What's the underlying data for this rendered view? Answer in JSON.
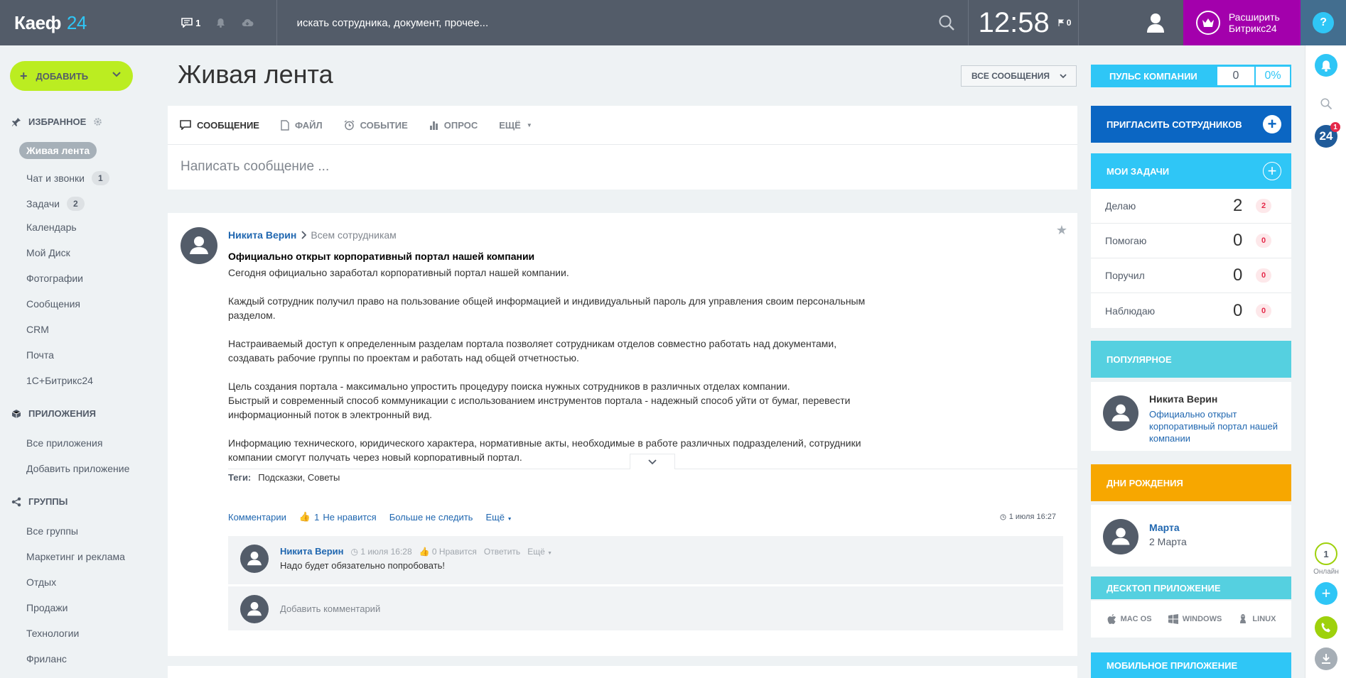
{
  "header": {
    "logo_text": "Каеф",
    "logo_num": "24",
    "chat_count": "1",
    "search_placeholder": "искать сотрудника, документ, прочее...",
    "time": "12:58",
    "flag_count": "0",
    "expand_line1": "Расширить",
    "expand_line2": "Битрикс24",
    "help": "?"
  },
  "sidebar": {
    "add_label": "ДОБАВИТЬ",
    "favorites_label": "ИЗБРАННОЕ",
    "favorites": [
      {
        "label": "Живая лента"
      },
      {
        "label": "Чат и звонки",
        "badge": "1"
      },
      {
        "label": "Задачи",
        "badge": "2"
      },
      {
        "label": "Календарь"
      },
      {
        "label": "Мой Диск"
      },
      {
        "label": "Фотографии"
      },
      {
        "label": "Сообщения"
      },
      {
        "label": "CRM"
      },
      {
        "label": "Почта"
      },
      {
        "label": "1С+Битрикс24"
      }
    ],
    "apps_label": "ПРИЛОЖЕНИЯ",
    "apps": [
      {
        "label": "Все приложения"
      },
      {
        "label": "Добавить приложение"
      }
    ],
    "groups_label": "ГРУППЫ",
    "groups": [
      {
        "label": "Все группы"
      },
      {
        "label": "Маркетинг и реклама"
      },
      {
        "label": "Отдых"
      },
      {
        "label": "Продажи"
      },
      {
        "label": "Технологии"
      },
      {
        "label": "Фриланс"
      }
    ]
  },
  "main": {
    "title": "Живая лента",
    "filter_label": "ВСЕ СООБЩЕНИЯ",
    "composer": {
      "tabs": [
        "СООБЩЕНИЕ",
        "ФАЙЛ",
        "СОБЫТИЕ",
        "ОПРОС",
        "ЕЩЁ"
      ],
      "placeholder": "Написать сообщение ..."
    },
    "post": {
      "author": "Никита Верин",
      "destination": "Всем сотрудникам",
      "title": "Официально открыт корпоративный портал нашей компании",
      "paragraphs": [
        "Сегодня официально заработал корпоративный портал нашей компании.",
        "Каждый сотрудник получил право на пользование общей информацией и индивидуальный пароль для управления своим персональным разделом.",
        "Настраиваемый доступ к определенным разделам портала позволяет сотрудникам отделов совместно работать над документами, создавать рабочие группы по проектам и работать над общей отчетностью.",
        "Цель создания портала - максимально упростить процедуру поиска нужных сотрудников в различных отделах компании.",
        "Быстрый и современный способ коммуникации с использованием инструментов портала - надежный способ уйти от бумаг, перевести информационный поток в электронный вид.",
        "Информацию технического, юридического характера, нормативные акты, необходимые в работе различных подразделений, сотрудники компании смогут получать через новый корпоративный портал."
      ],
      "tags_label": "Теги:",
      "tags": "Подсказки, Советы",
      "actions": {
        "comments": "Комментарии",
        "like_count": "1",
        "like_label": "Не нравится",
        "unfollow": "Больше не следить",
        "more": "Ещё",
        "date": "1 июля 16:27"
      },
      "comment": {
        "author": "Никита Верин",
        "date": "1 июля 16:28",
        "likes": "0 Нравится",
        "reply": "Ответить",
        "more": "Ещё",
        "text": "Надо будет обязательно попробовать!"
      },
      "add_comment_placeholder": "Добавить комментарий"
    }
  },
  "right": {
    "pulse": {
      "label": "ПУЛЬС КОМПАНИИ",
      "value": "0",
      "percent": "0%"
    },
    "invite_label": "ПРИГЛАСИТЬ СОТРУДНИКОВ",
    "tasks_label": "МОИ ЗАДАЧИ",
    "tasks": [
      {
        "label": "Делаю",
        "count": "2",
        "badge": "2"
      },
      {
        "label": "Помогаю",
        "count": "0",
        "badge": "0"
      },
      {
        "label": "Поручил",
        "count": "0",
        "badge": "0"
      },
      {
        "label": "Наблюдаю",
        "count": "0",
        "badge": "0"
      }
    ],
    "popular_label": "ПОПУЛЯРНОЕ",
    "popular": {
      "name": "Никита Верин",
      "link": "Официально открыт корпоративный портал нашей компании"
    },
    "bday_label": "ДНИ РОЖДЕНИЯ",
    "bday": {
      "name": "Марта",
      "date": "2 Марта"
    },
    "desktop_label": "ДЕСКТОП ПРИЛОЖЕНИЕ",
    "desktop_os": [
      "MAC OS",
      "WINDOWS",
      "LINUX"
    ],
    "mobile_label": "МОБИЛЬНОЕ ПРИЛОЖЕНИЕ"
  },
  "rightbar": {
    "bitrix_badge": "24",
    "bitrix_count": "1",
    "online_count": "1",
    "online_label": "Онлайн"
  },
  "colors": {
    "topbar": "#535c69",
    "accent": "#2fc6f6",
    "add_button": "#bbed21",
    "expand": "#a300ac",
    "invite": "#0b66c3",
    "birthday": "#f7a700"
  }
}
